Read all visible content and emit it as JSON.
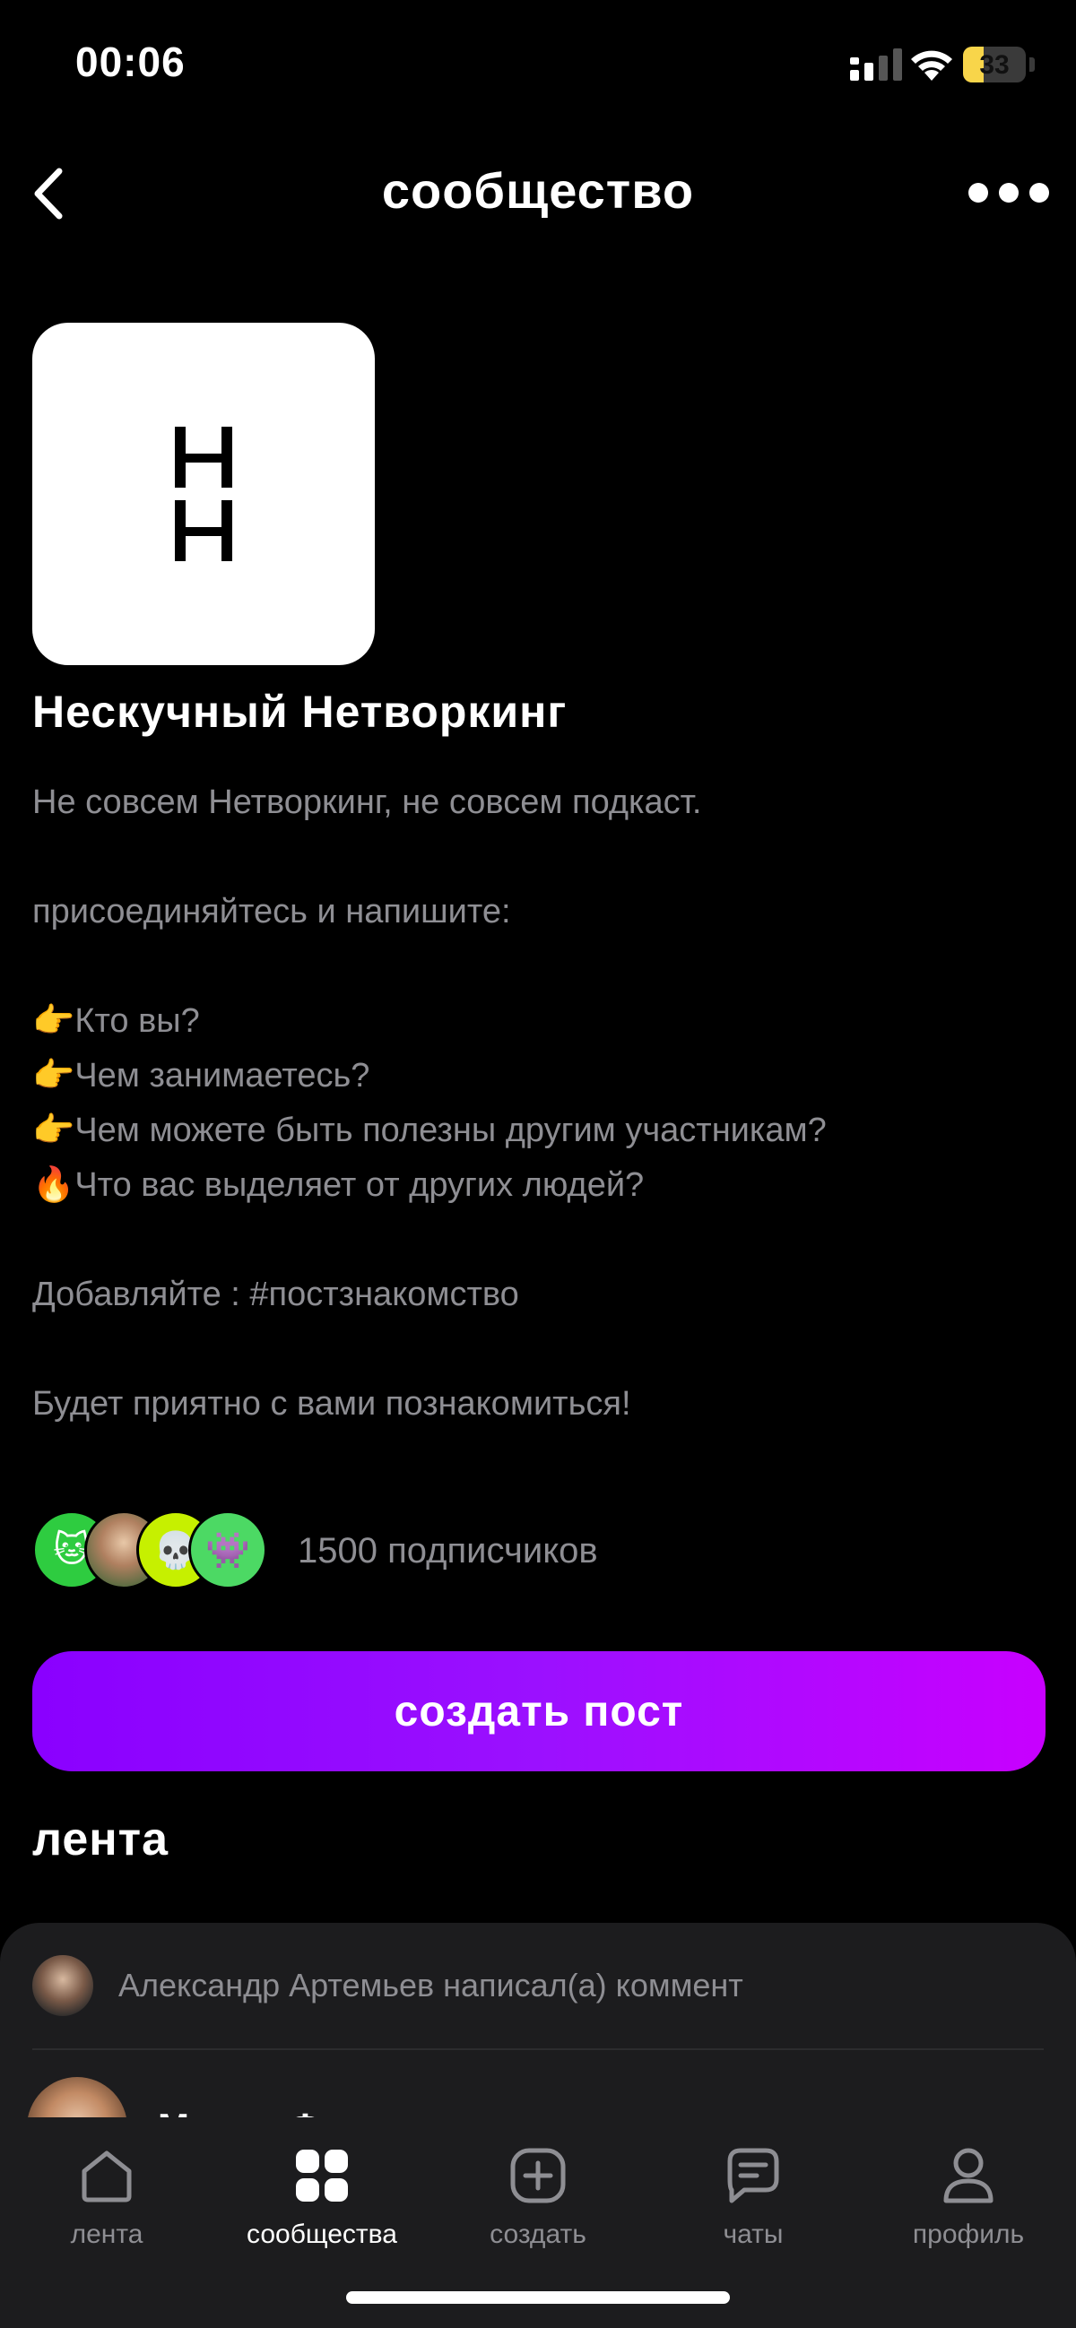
{
  "status_bar": {
    "time": "00:06",
    "battery": "33",
    "battery_level_percent": 33
  },
  "nav": {
    "title": "сообщество",
    "back_icon": "chevron-left-icon",
    "more_icon": "more-horizontal-icon"
  },
  "community": {
    "logo_text": "НН",
    "name": "Нескучный Нетворкинг",
    "description_lines": [
      "Не совсем Нетворкинг, не совсем подкаст.",
      "",
      "присоединяйтесь и напишите:",
      "",
      "👉Кто вы?",
      "👉Чем занимаетесь?",
      "👉Чем можете быть полезны другим участникам?",
      "🔥Что вас выделяет от других людей?",
      "",
      "Добавляйте : #постзнакомство",
      "",
      "Будет приятно с вами познакомиться!"
    ],
    "subscriber_avatars": [
      "🐱",
      "",
      "💀",
      "👾"
    ],
    "subscribers": "1500 подписчиков",
    "create_post": "создать пост"
  },
  "feed": {
    "title": "лента",
    "activity": "Александр Артемьев написал(а) коммент",
    "post_author": "Мария Фадеева"
  },
  "tabs": [
    {
      "label": "лента",
      "icon": "home-icon"
    },
    {
      "label": "сообщества",
      "icon": "grid-icon"
    },
    {
      "label": "создать",
      "icon": "plus-square-icon"
    },
    {
      "label": "чаты",
      "icon": "chat-icon"
    },
    {
      "label": "профиль",
      "icon": "user-icon"
    }
  ],
  "colors": {
    "background": "#000000",
    "accent_gradient_start": "#8a00ff",
    "accent_gradient_end": "#c800ff",
    "secondary_text": "#8e8e93",
    "card": "#1c1c1e"
  }
}
